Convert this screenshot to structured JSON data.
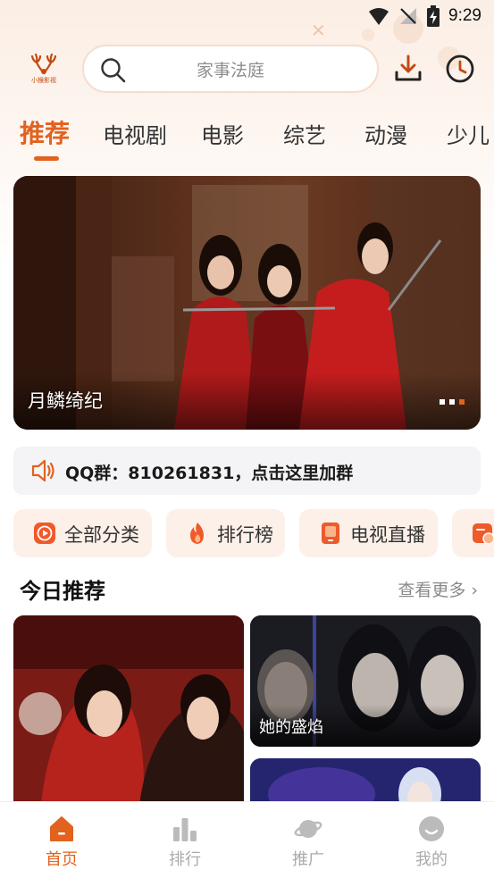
{
  "status_bar": {
    "time": "9:29"
  },
  "header": {
    "logo_text": "小猴影视",
    "search_placeholder": "家事法庭"
  },
  "tabs": [
    {
      "label": "推荐",
      "active": true
    },
    {
      "label": "电视剧"
    },
    {
      "label": "电影"
    },
    {
      "label": "综艺"
    },
    {
      "label": "动漫"
    },
    {
      "label": "少儿"
    }
  ],
  "banner": {
    "title": "月鳞绮纪",
    "page_count": 3,
    "active_page": 3
  },
  "notice": {
    "text": "QQ群：810261831，点击这里加群"
  },
  "quick_entries": [
    {
      "label": "全部分类",
      "icon": "play-icon"
    },
    {
      "label": "排行榜",
      "icon": "fire-icon"
    },
    {
      "label": "电视直播",
      "icon": "tv-icon"
    },
    {
      "label": "",
      "icon": "schedule-icon"
    }
  ],
  "section": {
    "title": "今日推荐",
    "more": "查看更多 ›"
  },
  "cards": [
    {
      "title": ""
    },
    {
      "title": "她的盛焰"
    },
    {
      "title": ""
    }
  ],
  "bottom_nav": [
    {
      "label": "首页",
      "icon": "home-icon",
      "active": true
    },
    {
      "label": "排行",
      "icon": "bar-chart-icon"
    },
    {
      "label": "推广",
      "icon": "planet-icon"
    },
    {
      "label": "我的",
      "icon": "profile-icon"
    }
  ],
  "colors": {
    "accent": "#e2621f",
    "quick_bg": "#fcf0e8",
    "notice_bg": "#f4f4f6",
    "inactive": "#aaaaaa"
  }
}
